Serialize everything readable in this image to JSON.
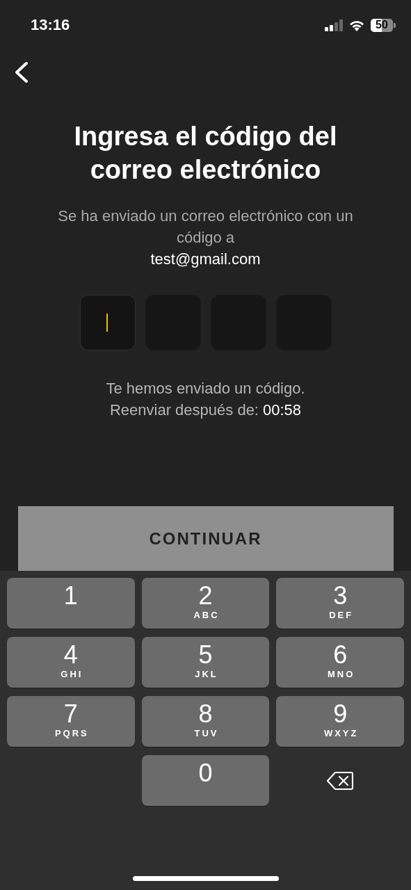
{
  "status_bar": {
    "time": "13:16",
    "battery": "50"
  },
  "title": "Ingresa el código del correo electrónico",
  "subtitle": "Se ha enviado un correo electrónico con un código a",
  "email": "test@gmail.com",
  "code_boxes": [
    {
      "focused": true
    },
    {
      "focused": false
    },
    {
      "focused": false
    },
    {
      "focused": false
    }
  ],
  "resend": {
    "message": "Te hemos enviado un código.",
    "label": "Reenviar después de:",
    "timer": "00:58"
  },
  "continue_button": {
    "label": "CONTINUAR",
    "disabled": true
  },
  "keypad": [
    {
      "kind": "digit",
      "digit": "1"
    },
    {
      "kind": "digit",
      "digit": "2",
      "letters": "ABC"
    },
    {
      "kind": "digit",
      "digit": "3",
      "letters": "DEF"
    },
    {
      "kind": "digit",
      "digit": "4",
      "letters": "GHI"
    },
    {
      "kind": "digit",
      "digit": "5",
      "letters": "JKL"
    },
    {
      "kind": "digit",
      "digit": "6",
      "letters": "MNO"
    },
    {
      "kind": "digit",
      "digit": "7",
      "letters": "PQRS"
    },
    {
      "kind": "digit",
      "digit": "8",
      "letters": "TUV"
    },
    {
      "kind": "digit",
      "digit": "9",
      "letters": "WXYZ"
    },
    {
      "kind": "blank"
    },
    {
      "kind": "digit",
      "digit": "0"
    },
    {
      "kind": "delete"
    }
  ]
}
